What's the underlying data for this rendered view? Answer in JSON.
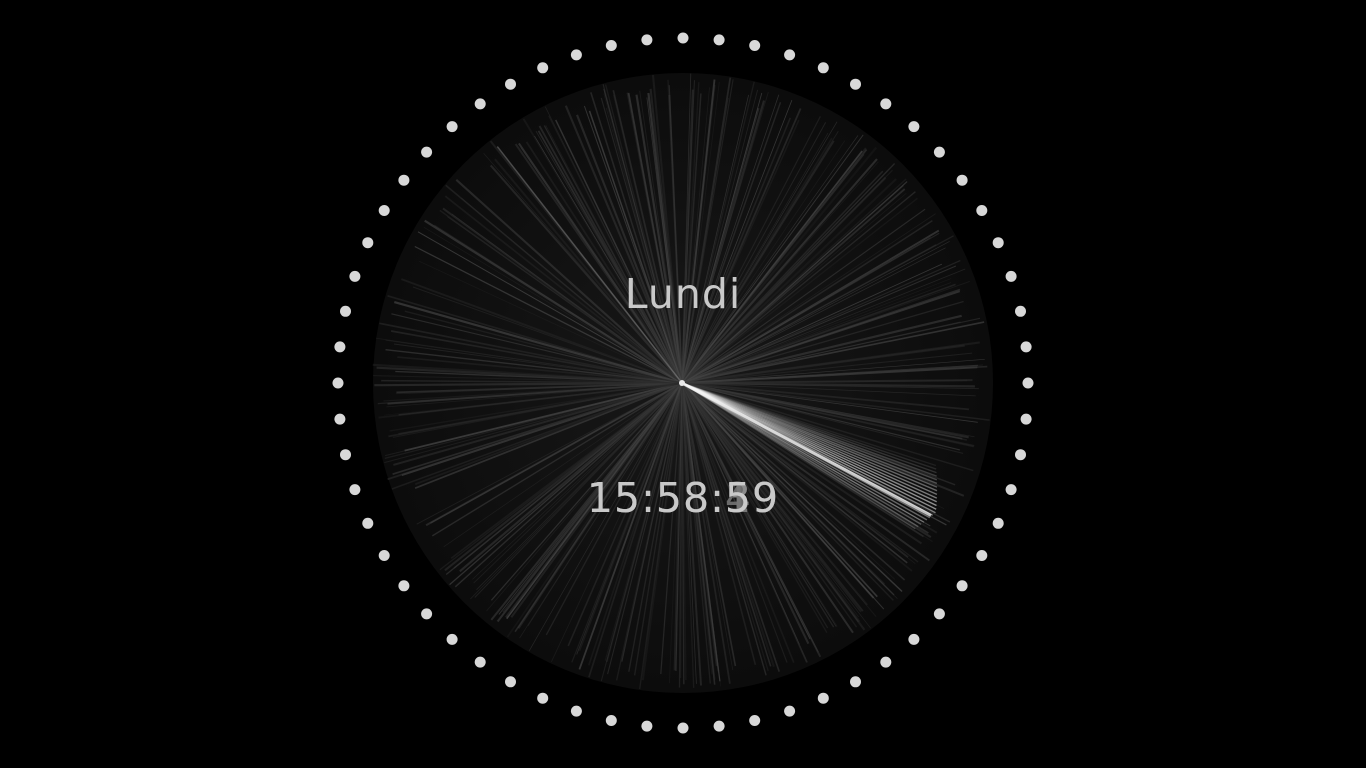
{
  "clock": {
    "day_label": "Lundi",
    "time_ghosts": [
      "15:58:49",
      "15:58:39",
      "15:58:19"
    ],
    "time_current": "15:58:59",
    "dot_count": 60,
    "colors": {
      "background": "#000000",
      "dots": "#d8d8d8",
      "text": "#c9c9c9",
      "sweep": "#ffffff"
    }
  }
}
